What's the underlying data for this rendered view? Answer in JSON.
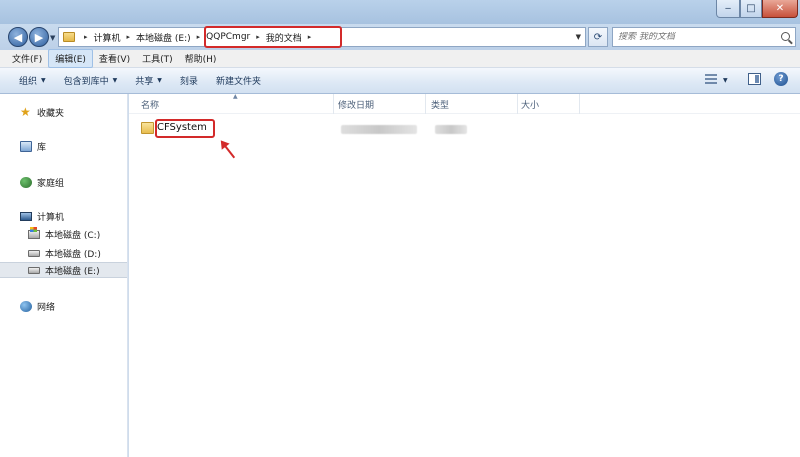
{
  "window": {
    "minimize_glyph": "‒",
    "maximize_glyph": "□",
    "close_glyph": "✕"
  },
  "address_bar": {
    "breadcrumbs": [
      "计算机",
      "本地磁盘 (E:)",
      "QQPCmgr",
      "我的文档"
    ],
    "separator": "▸"
  },
  "search": {
    "placeholder": "搜索 我的文档"
  },
  "menu": {
    "items": [
      "文件(F)",
      "编辑(E)",
      "查看(V)",
      "工具(T)",
      "帮助(H)"
    ],
    "active_index": 1
  },
  "toolbar": {
    "organize": "组织",
    "include_library": "包含到库中",
    "share": "共享",
    "burn": "刻录",
    "new_folder": "新建文件夹"
  },
  "nav": {
    "favorites": "收藏夹",
    "libraries": "库",
    "homegroup": "家庭组",
    "computer": "计算机",
    "drive_c": "本地磁盘 (C:)",
    "drive_d": "本地磁盘 (D:)",
    "drive_e": "本地磁盘 (E:)",
    "network": "网络",
    "selected": "drive_e"
  },
  "columns": {
    "name": "名称",
    "date": "修改日期",
    "type": "类型",
    "size": "大小"
  },
  "files": [
    {
      "name": "CFSystem"
    }
  ],
  "annotation_color": "#d32a2a"
}
